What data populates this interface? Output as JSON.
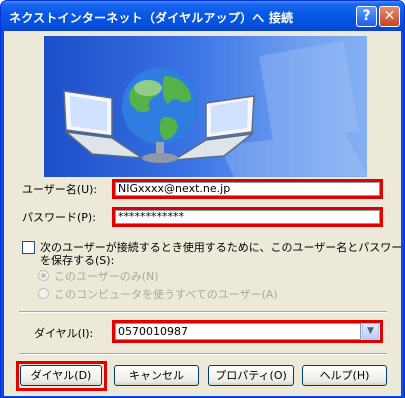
{
  "window": {
    "title": "ネクストインターネット（ダイヤルアップ）へ 接続",
    "help_button": "?",
    "close_button": "✕"
  },
  "form": {
    "username_label": "ユーザー名(U):",
    "username_value": "NIGxxxx@next.ne.jp",
    "password_label": "パスワード(P):",
    "password_value": "************",
    "save_checkbox_label_line1": "次のユーザーが接続するとき使用するために、このユーザー名とパスワード",
    "save_checkbox_label_line2": "を保存する(S):",
    "radio_me_only": "このユーザーのみ(N)",
    "radio_all_users": "このコンピュータを使うすべてのユーザー(A)",
    "dial_label": "ダイヤル(I):",
    "dial_value": "0570010987",
    "save_checked": false,
    "selected_radio": "me_only"
  },
  "buttons": {
    "dial": "ダイヤル(D)",
    "cancel": "キャンセル",
    "properties": "プロパティ(O)",
    "help": "ヘルプ(H)"
  },
  "colors": {
    "titlebar": "#0858e6",
    "dialog_bg": "#ece9d8",
    "highlight": "#e00000"
  },
  "icons": {
    "banner": "network-connection-globe-laptops-icon",
    "dropdown": "chevron-down-icon"
  }
}
